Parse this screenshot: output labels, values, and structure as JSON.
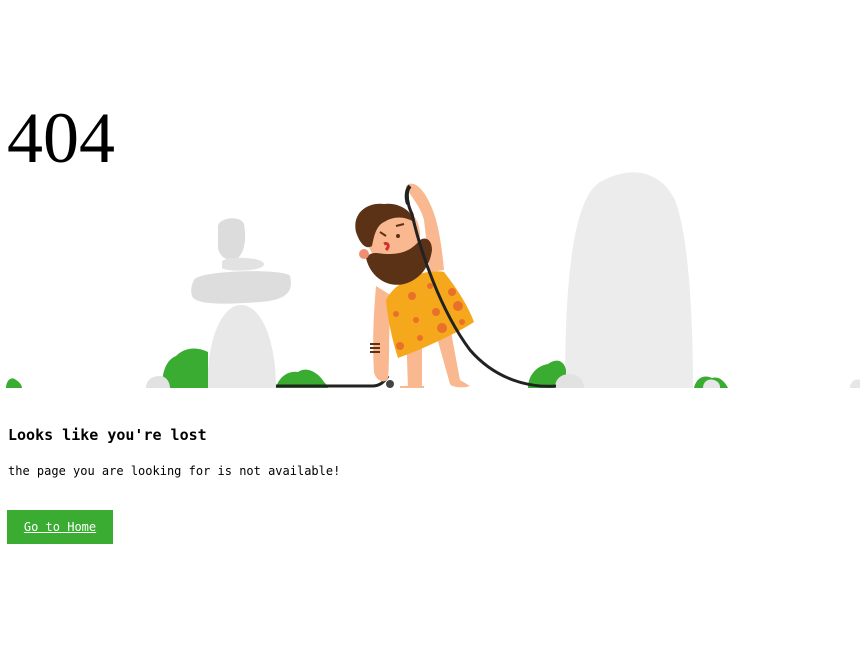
{
  "error": {
    "code": "404",
    "headline": "Looks like you're lost",
    "message": "the page you are looking for is not available!"
  },
  "actions": {
    "home_label": "Go to Home"
  },
  "illustration": {
    "subject": "caveman holding cable",
    "colors": {
      "rock": "#e6e6e6",
      "bush": "#39ac31",
      "skin": "#f9b88f",
      "hair": "#5b3216",
      "tunic": "#f6a81c",
      "tunic_spots": "#e8702a",
      "cable": "#222222"
    }
  },
  "colors": {
    "accent": "#39ac31",
    "text": "#000000",
    "background": "#ffffff"
  }
}
